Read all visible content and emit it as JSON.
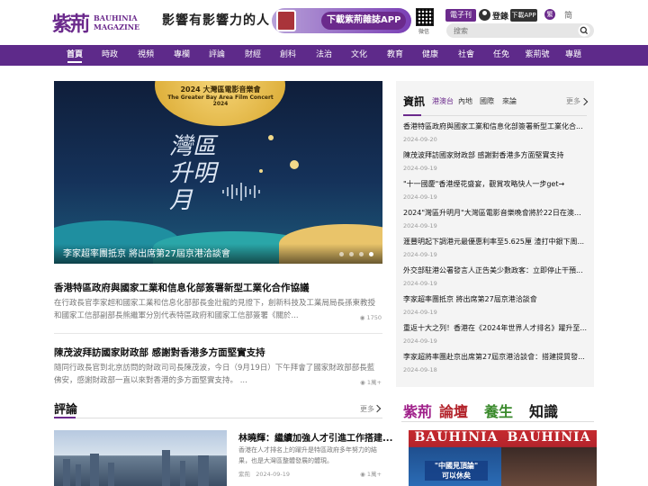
{
  "header": {
    "logo_cn": "紫荊",
    "logo_en_1": "BAUHINIA",
    "logo_en_2": "MAGAZINE",
    "slogan": "影響有影響力的人",
    "app_banner": "下載紫荊雜誌APP",
    "qr_label": "微信",
    "e_journal": "電子刊 (E)",
    "login": "登錄",
    "download_app": "下載APP",
    "lang_trad": "繁",
    "lang_simp": "简",
    "search_placeholder": "搜索"
  },
  "nav": {
    "items": [
      "首頁",
      "時政",
      "視頻",
      "專欄",
      "評論",
      "財經",
      "創科",
      "法治",
      "文化",
      "教育",
      "健康",
      "社會",
      "任免",
      "紫荊號",
      "專題"
    ],
    "active": "首頁"
  },
  "hero": {
    "event_title": "2024 大灣區電影音樂會",
    "event_subtitle": "The Greater Bay Area Film Concert 2024",
    "calligraphy": "灣區升明月",
    "caption": "李家超率團抵京 將出席第27屆京港洽談會"
  },
  "articles": [
    {
      "title": "香港特區政府與國家工業和信息化部簽署新型工業化合作協議",
      "body": "在行政長官李家超和國家工業和信息化部部長金壯龍的見證下，創新科技及工業局局長孫東教授和國家工信部副部長熊繼軍分別代表特區政府和國家工信部簽署《關於...",
      "views": "1750"
    },
    {
      "title": "陳茂波拜訪國家財政部 感謝對香港多方面堅實支持",
      "body": "隨同行政長官到北京訪問的財政司司長陳茂波，今日（9月19日）下午拜會了國家財政部部長藍佛安，感謝財政部一直以來對香港的多方面堅實支持。 ...",
      "views": "1萬+"
    }
  ],
  "opinion": {
    "section_title": "評論",
    "more": "更多",
    "title": "林曉輝：繼續加強人才引進工作搭建...",
    "body": "香港在人才排名上的躍升是特區政府多年努力的結果，也是大灣區整體發展的體現。",
    "meta_tag": "紫荊",
    "meta_date": "2024-09-19",
    "views": "1萬+"
  },
  "news": {
    "title": "資訊",
    "tabs": [
      "港澳台",
      "內地",
      "國際",
      "來論"
    ],
    "active_tab": "港澳台",
    "more": "更多",
    "items": [
      {
        "title": "香港特區政府與國家工業和信息化部簽署新型工業化合...",
        "date": "2024-09-20"
      },
      {
        "title": "陳茂波拜訪國家財政部 感謝對香港多方面堅實支持",
        "date": "2024-09-19"
      },
      {
        "title": "\"十一國慶\"香港煙花盛宴，觀賞攻略快人一步get→",
        "date": "2024-09-19"
      },
      {
        "title": "2024\"灣區升明月\"大灣區電影音樂晚會將於22日在澳門...",
        "date": "2024-09-19"
      },
      {
        "title": "滙豐明起下調港元最優惠利率至5.625厘 渣打中銀下周...",
        "date": "2024-09-19"
      },
      {
        "title": "外交部駐港公署發言人正告美少數政客：立即停止干預...",
        "date": "2024-09-19"
      },
      {
        "title": "李家超率團抵京 將出席第27屆京港洽談會",
        "date": "2024-09-19"
      },
      {
        "title": "重返十大之列！香港在《2024年世界人才排名》躍升至...",
        "date": "2024-09-19"
      },
      {
        "title": "李家超將率團赴京出席第27屆京港洽談會：搭建提質發...",
        "date": "2024-09-18"
      }
    ]
  },
  "brands": [
    "紫荊",
    "論壇",
    "養生",
    "知識"
  ],
  "magazines": [
    {
      "head": "BAUHINIA",
      "sub_1": "\"中國見頂論\"",
      "sub_2": "可以休矣"
    },
    {
      "head": "BAUHINIA",
      "sub_1": "",
      "sub_2": ""
    }
  ],
  "colors": {
    "brand_purple": "#5e2a8a",
    "accent_purple": "#6b2a8c"
  }
}
